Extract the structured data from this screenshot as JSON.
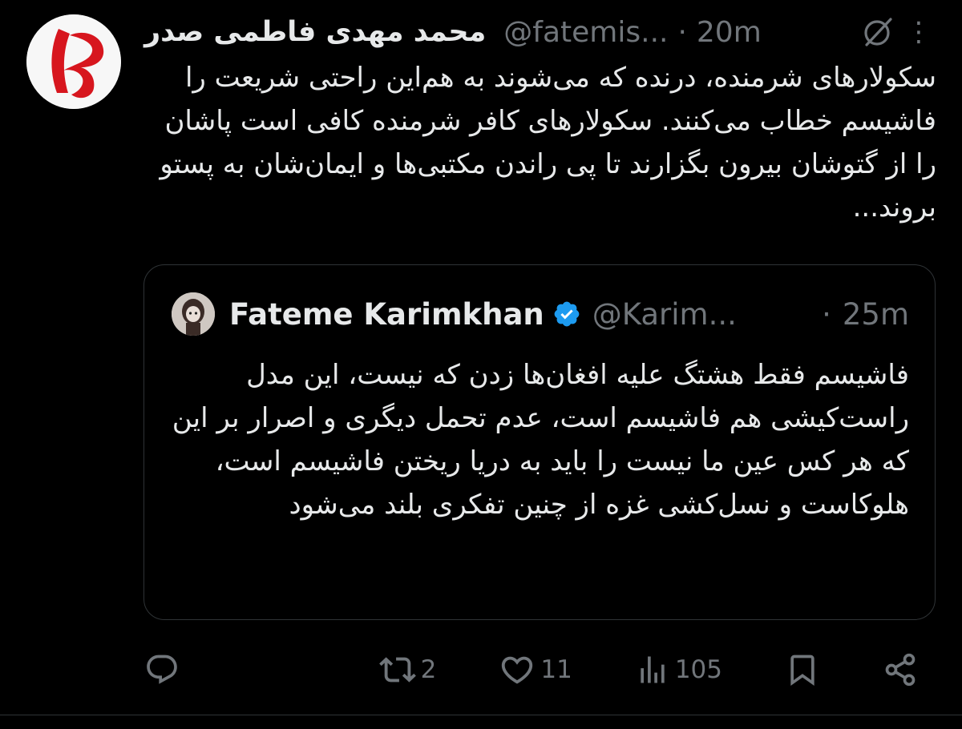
{
  "tweet": {
    "author_name": "محمد مهدی فاطمی صدر",
    "handle": "@fatemis...",
    "time": "20m",
    "body": "سکولارهای شرمنده، درنده که می‌شوند به هم‌این راحتی شریعت را فاشیسم خطاب می‌کنند. سکولارهای کافر شرمنده کافی است پاشان را از  گتوشان بیرون بگزارند تا پی راندن مکتبی‌ها و ایمان‌شان به پستو بروند...",
    "avatar_icon": "brand-logo-icon",
    "brand_color": "#d7161e"
  },
  "quoted_tweet": {
    "author_name": "Fateme Karimkhan",
    "handle": "@Karim...",
    "time": "25m",
    "verified_icon": "verified-badge-icon",
    "verified_color": "#1d9bf0",
    "body": "فاشیسم فقط هشتگ علیه افغان‌ها زدن که نیست، این مدل راست‌کیشی هم فاشیسم است، عدم تحمل دیگری و اصرار بر این که هر کس عین ما نیست را باید به دریا ریختن فاشیسم است، هلوکاست و نسل‌کشی غزه از چنین تفکری بلند می‌شود"
  },
  "actions": {
    "reply_icon": "reply-icon",
    "retweet_icon": "retweet-icon",
    "retweet_count": "2",
    "like_icon": "heart-icon",
    "like_count": "11",
    "views_icon": "views-icon",
    "views_count": "105",
    "bookmark_icon": "bookmark-icon",
    "share_icon": "share-icon"
  },
  "header_icons": {
    "grok_icon": "grok-icon",
    "more_icon": "more-options-icon",
    "more_glyph": "⋮"
  },
  "colors": {
    "background": "#000000",
    "text": "#e7e9ea",
    "secondary": "#71767b",
    "border": "#2f3336"
  }
}
